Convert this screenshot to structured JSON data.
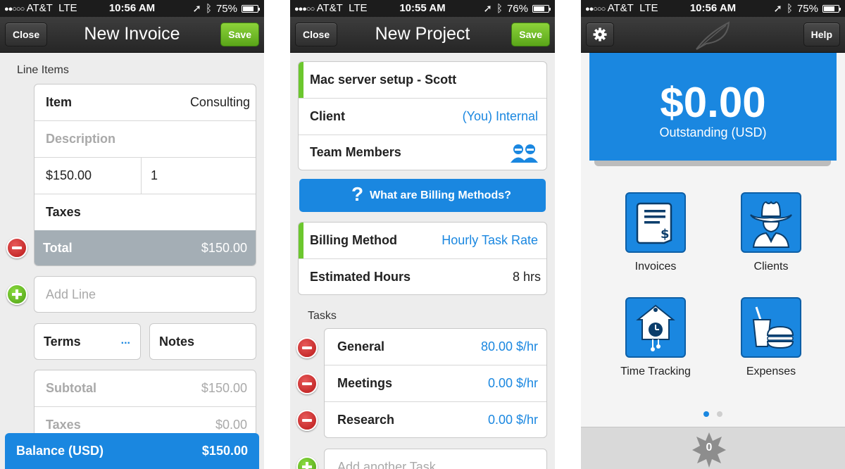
{
  "status_bars": [
    {
      "carrier": "AT&T",
      "network": "LTE",
      "time": "10:56 AM",
      "battery": "75%",
      "battery_level": 0.75
    },
    {
      "carrier": "AT&T",
      "network": "LTE",
      "time": "10:55 AM",
      "battery": "76%",
      "battery_level": 0.76
    },
    {
      "carrier": "AT&T",
      "network": "LTE",
      "time": "10:56 AM",
      "battery": "75%",
      "battery_level": 0.75
    }
  ],
  "invoice": {
    "close_label": "Close",
    "title": "New Invoice",
    "save_label": "Save",
    "section_label": "Line Items",
    "item_label": "Item",
    "item_value": "Consulting",
    "description_placeholder": "Description",
    "price": "$150.00",
    "quantity": "1",
    "taxes_label": "Taxes",
    "total_label": "Total",
    "total_value": "$150.00",
    "add_line_placeholder": "Add Line",
    "terms_label": "Terms",
    "terms_more": "...",
    "notes_label": "Notes",
    "subtotal_label": "Subtotal",
    "subtotal_value": "$150.00",
    "taxes_summary_label": "Taxes",
    "taxes_summary_value": "$0.00",
    "balance_label": "Balance (USD)",
    "balance_value": "$150.00"
  },
  "project": {
    "close_label": "Close",
    "title": "New Project",
    "save_label": "Save",
    "project_name": "Mac server setup - Scott",
    "client_label": "Client",
    "client_value": "(You) Internal",
    "team_label": "Team Members",
    "billing_help": "What are Billing Methods?",
    "billing_label": "Billing Method",
    "billing_value": "Hourly Task Rate",
    "hours_label": "Estimated Hours",
    "hours_value": "8 hrs",
    "tasks_label": "Tasks",
    "tasks": [
      {
        "name": "General",
        "rate": "80.00 $/hr"
      },
      {
        "name": "Meetings",
        "rate": "0.00 $/hr"
      },
      {
        "name": "Research",
        "rate": "0.00 $/hr"
      }
    ],
    "add_task_placeholder": "Add another Task"
  },
  "dashboard": {
    "help_label": "Help",
    "outstanding_amount": "$0.00",
    "outstanding_label": "Outstanding (USD)",
    "tiles": [
      {
        "label": "Invoices",
        "icon": "invoice-icon"
      },
      {
        "label": "Clients",
        "icon": "cowboy-icon"
      },
      {
        "label": "Time Tracking",
        "icon": "cuckoo-clock-icon"
      },
      {
        "label": "Expenses",
        "icon": "food-drink-icon"
      }
    ],
    "notification_count": "0"
  },
  "colors": {
    "accent_blue": "#1a87e0",
    "save_green": "#5aa519",
    "delete_red": "#c92323",
    "total_bar_gray": "#a4aeb5"
  }
}
